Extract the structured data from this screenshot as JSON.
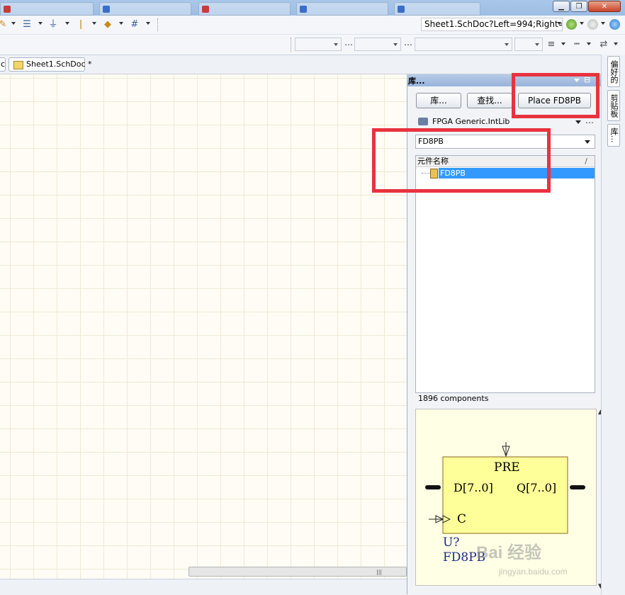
{
  "address_bar": {
    "value": "Sheet1.SchDoc?Left=994;Right="
  },
  "document_tabs": [
    {
      "label": "c"
    },
    {
      "label": "Sheet1.SchDoc *"
    }
  ],
  "library_panel": {
    "title": "库...",
    "buttons": {
      "libraries": "库...",
      "search": "查找...",
      "place": "Place FD8PB"
    },
    "library_selected": "FPGA Generic.IntLib",
    "filter_value": "FD8PB",
    "list": {
      "column_header": "元件名称",
      "sort_indicator": "/",
      "rows": [
        {
          "name": "FD8PB",
          "selected": true
        }
      ]
    },
    "component_count": "1896 components",
    "preview": {
      "pin_top": "PRE",
      "pin_left": "D[7..0]",
      "pin_right": "Q[7..0]",
      "pin_clock": "C",
      "designator": "U?",
      "comment": "FD8PB"
    }
  },
  "right_strip_tabs": [
    {
      "label": "偏好的"
    },
    {
      "label": "剪贴板"
    },
    {
      "label": "库..."
    }
  ],
  "watermark": {
    "main": "Bai 经验",
    "sub": "jingyan.baidu.com"
  },
  "colors": {
    "highlight": "#e8333f",
    "selection": "#3399ff",
    "preview_bg": "#ffffe5",
    "symbol_fill": "#ffff99",
    "symbol_text": "#1a2a8a",
    "canvas_bg": "#fefcf4"
  },
  "icons": {
    "titlebar_buttons": [
      "minimize-icon",
      "maximize-icon",
      "close-icon"
    ],
    "toolbar": [
      "pencil-icon",
      "bus-icon",
      "ground-icon",
      "pin-icon",
      "port-icon",
      "grid-icon"
    ],
    "nav": [
      "back-icon",
      "forward-icon",
      "globe-icon"
    ],
    "panel_header": [
      "dropdown-icon",
      "pin-icon",
      "close-icon"
    ]
  }
}
